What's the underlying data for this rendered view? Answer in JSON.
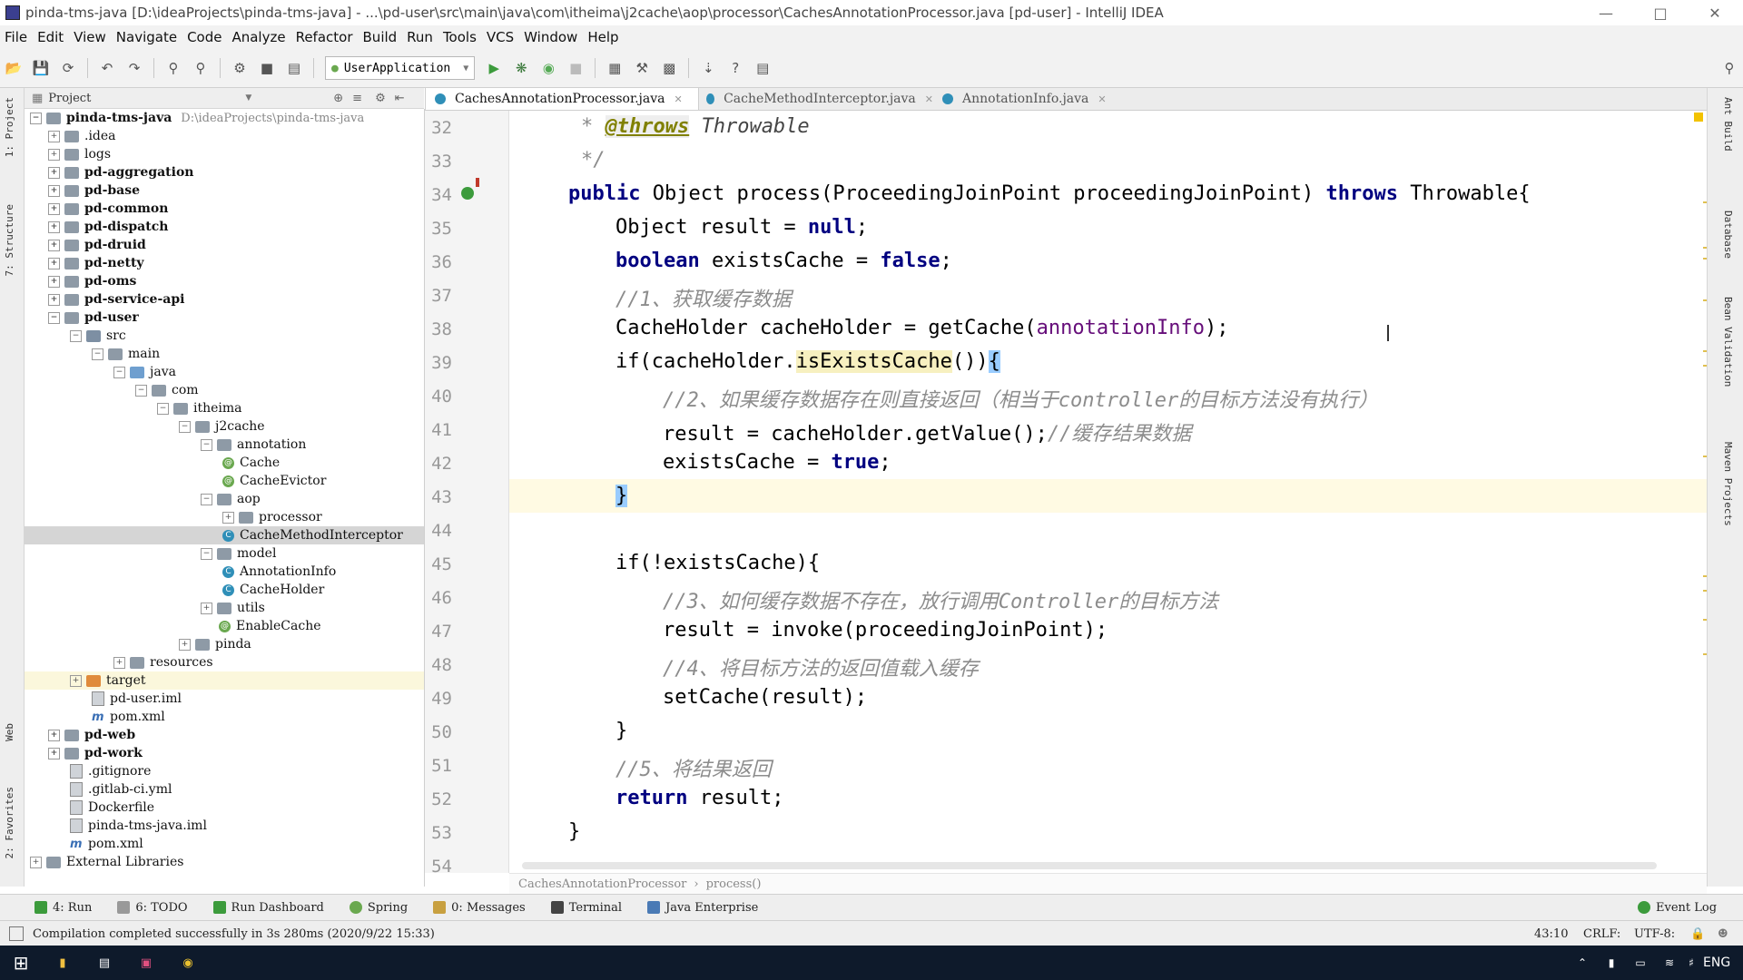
{
  "window": {
    "title": "pinda-tms-java [D:\\ideaProjects\\pinda-tms-java] - ...\\pd-user\\src\\main\\java\\com\\itheima\\j2cache\\aop\\processor\\CachesAnnotationProcessor.java [pd-user] - IntelliJ IDEA"
  },
  "menu": [
    "File",
    "Edit",
    "View",
    "Navigate",
    "Code",
    "Analyze",
    "Refactor",
    "Build",
    "Run",
    "Tools",
    "VCS",
    "Window",
    "Help"
  ],
  "toolbar": {
    "run_config": "UserApplication"
  },
  "side_tabs": {
    "left": [
      "1: Project",
      "7: Structure",
      "Web",
      "2: Favorites"
    ],
    "right": [
      "Ant Build",
      "Database",
      "Bean Validation",
      "Maven Projects"
    ]
  },
  "project_panel": {
    "title": "Project",
    "root_label": "pinda-tms-java",
    "root_path": "D:\\ideaProjects\\pinda-tms-java",
    "nodes": [
      {
        "label": ".idea"
      },
      {
        "label": "logs"
      },
      {
        "label": "pd-aggregation"
      },
      {
        "label": "pd-base"
      },
      {
        "label": "pd-common"
      },
      {
        "label": "pd-dispatch"
      },
      {
        "label": "pd-druid"
      },
      {
        "label": "pd-netty"
      },
      {
        "label": "pd-oms"
      },
      {
        "label": "pd-service-api"
      },
      {
        "label": "pd-user"
      },
      {
        "label": "src"
      },
      {
        "label": "main"
      },
      {
        "label": "java"
      },
      {
        "label": "com"
      },
      {
        "label": "itheima"
      },
      {
        "label": "j2cache"
      },
      {
        "label": "annotation"
      },
      {
        "label": "Cache"
      },
      {
        "label": "CacheEvictor"
      },
      {
        "label": "aop"
      },
      {
        "label": "processor"
      },
      {
        "label": "CacheMethodInterceptor"
      },
      {
        "label": "model"
      },
      {
        "label": "AnnotationInfo"
      },
      {
        "label": "CacheHolder"
      },
      {
        "label": "utils"
      },
      {
        "label": "EnableCache"
      },
      {
        "label": "pinda"
      },
      {
        "label": "resources"
      },
      {
        "label": "target"
      },
      {
        "label": "pd-user.iml"
      },
      {
        "label": "pom.xml"
      },
      {
        "label": "pd-web"
      },
      {
        "label": "pd-work"
      },
      {
        "label": ".gitignore"
      },
      {
        "label": ".gitlab-ci.yml"
      },
      {
        "label": "Dockerfile"
      },
      {
        "label": "pinda-tms-java.iml"
      },
      {
        "label": "pom.xml"
      },
      {
        "label": "External Libraries"
      }
    ]
  },
  "editor_tabs": [
    {
      "label": "CachesAnnotationProcessor.java"
    },
    {
      "label": "CacheMethodInterceptor.java"
    },
    {
      "label": "AnnotationInfo.java"
    }
  ],
  "code": {
    "line_numbers": [
      "32",
      "33",
      "34",
      "35",
      "36",
      "37",
      "38",
      "39",
      "40",
      "41",
      "42",
      "43",
      "44",
      "45",
      "46",
      "47",
      "48",
      "49",
      "50",
      "51",
      "52",
      "53",
      "54"
    ],
    "l32_star": "* ",
    "l32_tag": "@throws",
    "l32_rest": " Throwable",
    "l33": "*/",
    "l34_kw1": "public",
    "l34_mid": " Object process(ProceedingJoinPoint proceedingJoinPoint) ",
    "l34_kw2": "throws",
    "l34_end": " Throwable{",
    "l35_a": "Object result = ",
    "l35_kw": "null",
    "l35_b": ";",
    "l36_kw": "boolean",
    "l36_a": " existsCache = ",
    "l36_kw2": "false",
    "l36_b": ";",
    "l37": "//1、获取缓存数据",
    "l38_a": "CacheHolder cacheHolder = getCache(",
    "l38_f": "annotationInfo",
    "l38_b": ");",
    "l39_a": "if(cacheHolder.",
    "l39_m": "isExistsCache",
    "l39_b": "())",
    "l39_br": "{",
    "l40": "//2、如果缓存数据存在则直接返回（相当于controller的目标方法没有执行）",
    "l41_a": "result = cacheHolder.getValue();",
    "l41_c": "//缓存结果数据",
    "l42_a": "existsCache = ",
    "l42_kw": "true",
    "l42_b": ";",
    "l43": "}",
    "l45": "if(!existsCache){",
    "l46": "//3、如何缓存数据不存在，放行调用Controller的目标方法",
    "l47": "result = invoke(proceedingJoinPoint);",
    "l48": "//4、将目标方法的返回值载入缓存",
    "l49": "setCache(result);",
    "l50": "}",
    "l51": "//5、将结果返回",
    "l52_kw": "return",
    "l52_b": " result;",
    "l53": "}"
  },
  "breadcrumb": {
    "class": "CachesAnnotationProcessor",
    "method": "process()"
  },
  "bottom_tabs": [
    "4: Run",
    "6: TODO",
    "Run Dashboard",
    "Spring",
    "0: Messages",
    "Terminal",
    "Java Enterprise",
    "Event Log"
  ],
  "status": {
    "message": "Compilation completed successfully in 3s 280ms (2020/9/22 15:33)",
    "position": "43:10",
    "line_sep": "CRLF:",
    "encoding": "UTF-8:"
  },
  "taskbar": {
    "lang": "ENG"
  }
}
